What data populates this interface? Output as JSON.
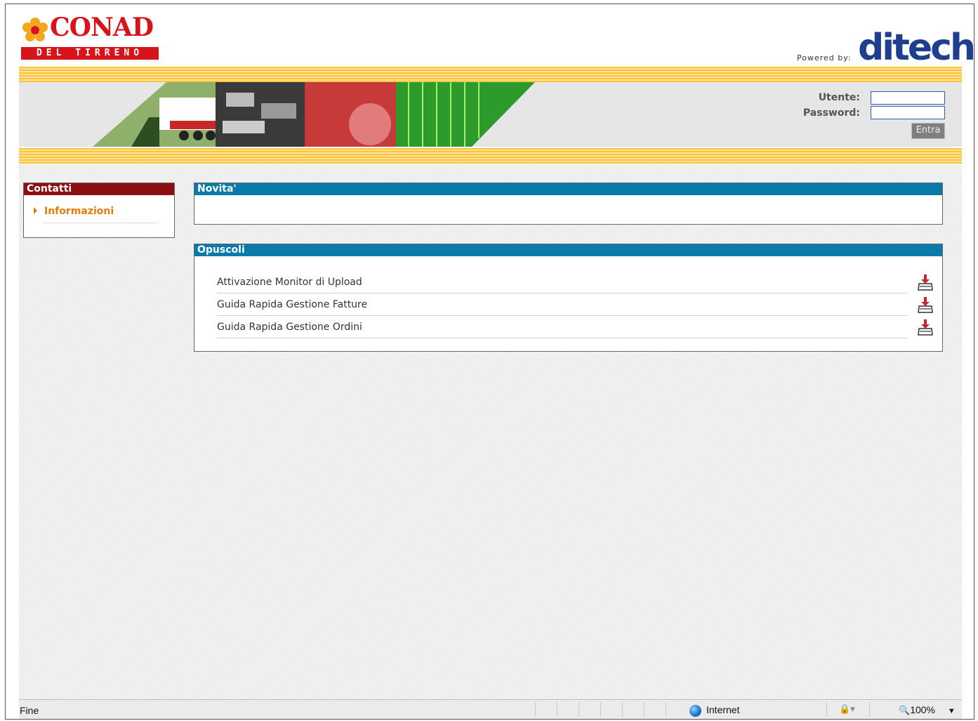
{
  "header": {
    "brand_name": "CONAD",
    "brand_sub": "DEL TIRRENO",
    "powered_by": "Powered by:",
    "partner_logo": "ditech"
  },
  "login": {
    "user_label": "Utente:",
    "password_label": "Password:",
    "user_value": "",
    "password_value": "",
    "submit_label": "Entra"
  },
  "sidebar": {
    "title": "Contatti",
    "items": [
      {
        "label": "Informazioni"
      }
    ]
  },
  "news": {
    "title": "Novita'"
  },
  "brochures": {
    "title": "Opuscoli",
    "items": [
      {
        "label": "Attivazione Monitor di Upload",
        "icon": "download-icon"
      },
      {
        "label": "Guida Rapida Gestione Fatture",
        "icon": "download-icon"
      },
      {
        "label": "Guida Rapida Gestione Ordini",
        "icon": "download-icon"
      }
    ]
  },
  "statusbar": {
    "status": "Fine",
    "zone": "Internet",
    "zoom": "100%"
  },
  "colors": {
    "brand_red": "#d7141a",
    "sidebar_header": "#8e0f12",
    "panel_header": "#0a7aa8",
    "link_orange": "#e07b0e",
    "stripe_yellow": "#f9c33a"
  }
}
